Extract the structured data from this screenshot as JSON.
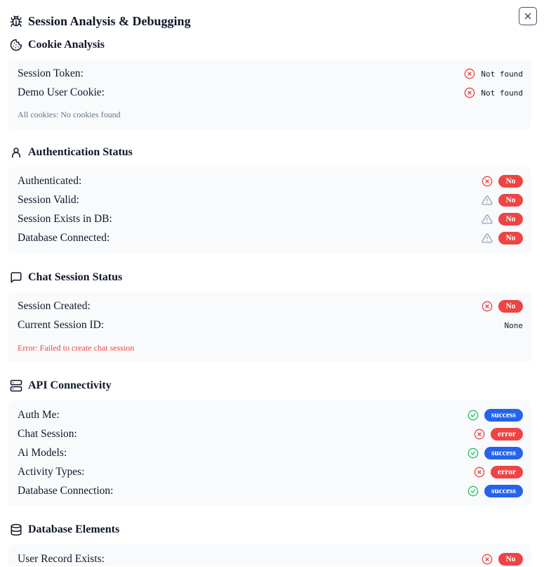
{
  "title": "Session Analysis & Debugging",
  "icons": {
    "title": "bug-icon",
    "close": "close-icon",
    "cookie": "cookie-icon",
    "auth": "user-icon",
    "chat": "message-square-icon",
    "api": "server-icon",
    "db": "database-icon"
  },
  "colors": {
    "fail": "#ef4444",
    "warn": "#94a3b8",
    "success_icon": "#22c55e",
    "success_badge": "#2563eb",
    "note_gray": "#64748b",
    "note_error": "#ef4444",
    "card_bg": "#f8fafc"
  },
  "cookie": {
    "heading": "Cookie Analysis",
    "rows": [
      {
        "label": "Session Token:",
        "status": "x-circle-icon",
        "value": "Not found"
      },
      {
        "label": "Demo User Cookie:",
        "status": "x-circle-icon",
        "value": "Not found"
      }
    ],
    "note": "All cookies: No cookies found"
  },
  "auth": {
    "heading": "Authentication Status",
    "rows": [
      {
        "label": "Authenticated:",
        "status": "x-circle-icon",
        "badge": "No"
      },
      {
        "label": "Session Valid:",
        "status": "alert-triangle-icon",
        "badge": "No"
      },
      {
        "label": "Session Exists in DB:",
        "status": "alert-triangle-icon",
        "badge": "No"
      },
      {
        "label": "Database Connected:",
        "status": "alert-triangle-icon",
        "badge": "No"
      }
    ]
  },
  "chat": {
    "heading": "Chat Session Status",
    "rows": [
      {
        "label": "Session Created:",
        "status": "x-circle-icon",
        "badge": "No"
      },
      {
        "label": "Current Session ID:",
        "value": "None"
      }
    ],
    "note": "Error: Failed to create chat session"
  },
  "api": {
    "heading": "API Connectivity",
    "rows": [
      {
        "label": "Auth Me:",
        "status": "check-circle-icon",
        "badge": "success"
      },
      {
        "label": "Chat Session:",
        "status": "x-circle-icon",
        "badge": "error"
      },
      {
        "label": "Ai Models:",
        "status": "check-circle-icon",
        "badge": "success"
      },
      {
        "label": "Activity Types:",
        "status": "x-circle-icon",
        "badge": "error"
      },
      {
        "label": "Database Connection:",
        "status": "check-circle-icon",
        "badge": "success"
      }
    ]
  },
  "db": {
    "heading": "Database Elements",
    "rows": [
      {
        "label": "User Record Exists:",
        "status": "x-circle-icon",
        "badge": "No"
      }
    ]
  }
}
